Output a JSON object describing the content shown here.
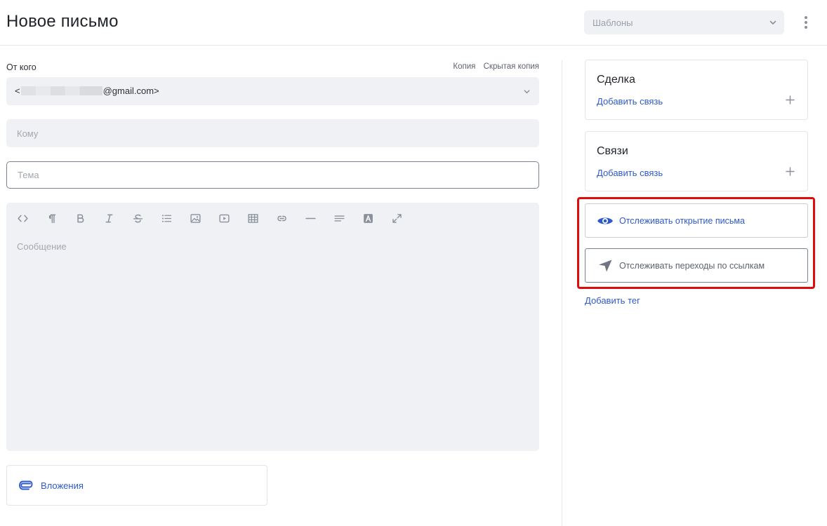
{
  "header": {
    "title": "Новое письмо",
    "templates_placeholder": "Шаблоны"
  },
  "from": {
    "label": "От кого",
    "value_prefix": "<",
    "value_suffix": "@gmail.com>",
    "cc_label": "Копия",
    "bcc_label": "Скрытая копия"
  },
  "to": {
    "placeholder": "Кому"
  },
  "subject": {
    "placeholder": "Тема"
  },
  "editor": {
    "placeholder": "Сообщение",
    "toolbar": [
      "code-icon",
      "paragraph-icon",
      "bold-icon",
      "italic-icon",
      "strikethrough-icon",
      "list-icon",
      "image-icon",
      "video-icon",
      "table-icon",
      "link-icon",
      "horizontal-rule-icon",
      "align-icon",
      "text-color-icon",
      "fullscreen-icon"
    ]
  },
  "attachments": {
    "label": "Вложения"
  },
  "sidebar": {
    "deal": {
      "title": "Сделка",
      "link": "Добавить связь"
    },
    "relations": {
      "title": "Связи",
      "link": "Добавить связь"
    },
    "track_open": {
      "label": "Отслеживать открытие письма"
    },
    "track_links": {
      "label": "Отслеживать переходы по ссылкам"
    },
    "add_tag": "Добавить тег"
  },
  "colors": {
    "accent": "#2e59c9",
    "field_bg": "#f0f1f5",
    "highlight": "#e00b0b",
    "icon_gray": "#8a909a"
  }
}
